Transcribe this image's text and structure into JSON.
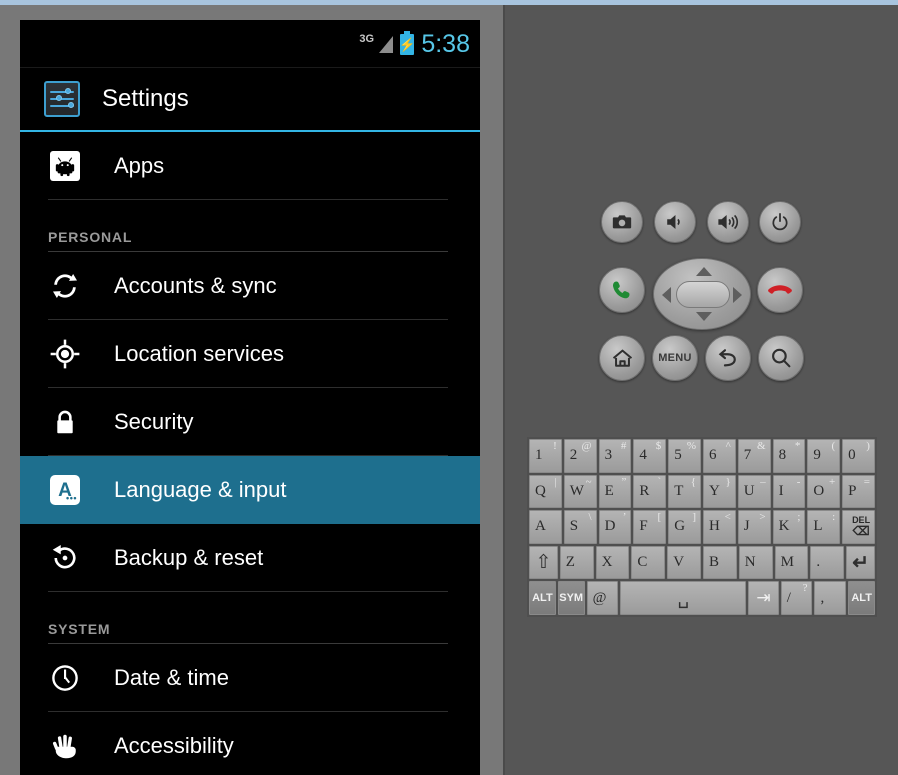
{
  "window": {
    "emulator_background": "#565656",
    "frame_color": "#787878",
    "accent_color": "#33b5e5",
    "highlight_color": "#1e6f8e"
  },
  "phone": {
    "status_bar": {
      "network_label": "3G",
      "signal_icon": "signal-triangle-icon",
      "battery_icon": "battery-charging-icon",
      "battery_bolt": "⚡",
      "clock": "5:38"
    },
    "action_bar": {
      "icon": "settings-sliders-icon",
      "title": "Settings"
    },
    "list": [
      {
        "kind": "item",
        "label": "Apps",
        "icon": "android-apps-icon",
        "selected": false
      },
      {
        "kind": "section",
        "label": "PERSONAL"
      },
      {
        "kind": "item",
        "label": "Accounts & sync",
        "icon": "sync-arrows-icon",
        "selected": false
      },
      {
        "kind": "item",
        "label": "Location services",
        "icon": "location-crosshair-icon",
        "selected": false
      },
      {
        "kind": "item",
        "label": "Security",
        "icon": "padlock-icon",
        "selected": false
      },
      {
        "kind": "item",
        "label": "Language & input",
        "icon": "language-a-icon",
        "selected": true
      },
      {
        "kind": "item",
        "label": "Backup & reset",
        "icon": "backup-restore-icon",
        "selected": false
      },
      {
        "kind": "section",
        "label": "SYSTEM"
      },
      {
        "kind": "item",
        "label": "Date & time",
        "icon": "clock-icon",
        "selected": false
      },
      {
        "kind": "item",
        "label": "Accessibility",
        "icon": "hand-icon",
        "selected": false
      }
    ]
  },
  "controls": {
    "row1": [
      {
        "name": "camera-button",
        "icon": "camera-icon",
        "label": ""
      },
      {
        "name": "volume-down-button",
        "icon": "volume-down-icon",
        "label": ""
      },
      {
        "name": "volume-up-button",
        "icon": "volume-up-icon",
        "label": ""
      },
      {
        "name": "power-button",
        "icon": "power-icon",
        "label": ""
      }
    ],
    "row2": [
      {
        "name": "call-button",
        "icon": "phone-call-green-icon",
        "label": ""
      },
      {
        "name": "end-call-button",
        "icon": "phone-hangup-red-icon",
        "label": ""
      }
    ],
    "dpad": {
      "name": "dpad",
      "up": "dpad-up-icon",
      "down": "dpad-down-icon",
      "left": "dpad-left-icon",
      "right": "dpad-right-icon",
      "center": "dpad-center-button"
    },
    "row3": [
      {
        "name": "home-button",
        "icon": "home-icon",
        "label": ""
      },
      {
        "name": "menu-button",
        "icon": "menu-icon",
        "label": "MENU"
      },
      {
        "name": "back-button",
        "icon": "back-arrow-icon",
        "label": ""
      },
      {
        "name": "search-button",
        "icon": "search-icon",
        "label": ""
      }
    ]
  },
  "keyboard": {
    "rows": [
      [
        {
          "main": "1",
          "alt": "!"
        },
        {
          "main": "2",
          "alt": "@"
        },
        {
          "main": "3",
          "alt": "#"
        },
        {
          "main": "4",
          "alt": "$"
        },
        {
          "main": "5",
          "alt": "%"
        },
        {
          "main": "6",
          "alt": "^"
        },
        {
          "main": "7",
          "alt": "&"
        },
        {
          "main": "8",
          "alt": "*"
        },
        {
          "main": "9",
          "alt": "("
        },
        {
          "main": "0",
          "alt": ")"
        }
      ],
      [
        {
          "main": "Q",
          "alt": "|"
        },
        {
          "main": "W",
          "alt": "~"
        },
        {
          "main": "E",
          "alt": "”"
        },
        {
          "main": "R",
          "alt": "`"
        },
        {
          "main": "T",
          "alt": "{"
        },
        {
          "main": "Y",
          "alt": "}"
        },
        {
          "main": "U",
          "alt": "–"
        },
        {
          "main": "I",
          "alt": "-"
        },
        {
          "main": "O",
          "alt": "+"
        },
        {
          "main": "P",
          "alt": "="
        }
      ],
      [
        {
          "main": "A",
          "alt": ""
        },
        {
          "main": "S",
          "alt": "\\"
        },
        {
          "main": "D",
          "alt": "’"
        },
        {
          "main": "F",
          "alt": "["
        },
        {
          "main": "G",
          "alt": "]"
        },
        {
          "main": "H",
          "alt": "<"
        },
        {
          "main": "J",
          "alt": ">"
        },
        {
          "main": "K",
          "alt": ";"
        },
        {
          "main": "L",
          "alt": ":"
        },
        {
          "main": "DEL",
          "alt": "",
          "type": "del",
          "sub": "⌫"
        }
      ],
      [
        {
          "main": "⇧",
          "alt": "",
          "type": "fn",
          "name": "shift-key"
        },
        {
          "main": "Z",
          "alt": ""
        },
        {
          "main": "X",
          "alt": ""
        },
        {
          "main": "C",
          "alt": ""
        },
        {
          "main": "V",
          "alt": ""
        },
        {
          "main": "B",
          "alt": ""
        },
        {
          "main": "N",
          "alt": ""
        },
        {
          "main": "M",
          "alt": ""
        },
        {
          "main": ".",
          "alt": ""
        },
        {
          "main": "↵",
          "alt": "",
          "type": "fn",
          "name": "enter-key"
        }
      ],
      [
        {
          "main": "ALT",
          "alt": "",
          "type": "dark",
          "name": "alt-left-key"
        },
        {
          "main": "SYM",
          "alt": "",
          "type": "dark",
          "name": "sym-key"
        },
        {
          "main": "@",
          "alt": "",
          "name": "at-key"
        },
        {
          "main": "␣",
          "alt": "",
          "type": "space",
          "name": "space-key"
        },
        {
          "main": "⇥",
          "alt": "",
          "type": "tab",
          "name": "tab-key"
        },
        {
          "main": "/",
          "alt": "?",
          "name": "slash-key"
        },
        {
          "main": ",",
          "alt": "",
          "name": "comma-key"
        },
        {
          "main": "ALT",
          "alt": "",
          "type": "dark",
          "name": "alt-right-key"
        }
      ]
    ]
  }
}
